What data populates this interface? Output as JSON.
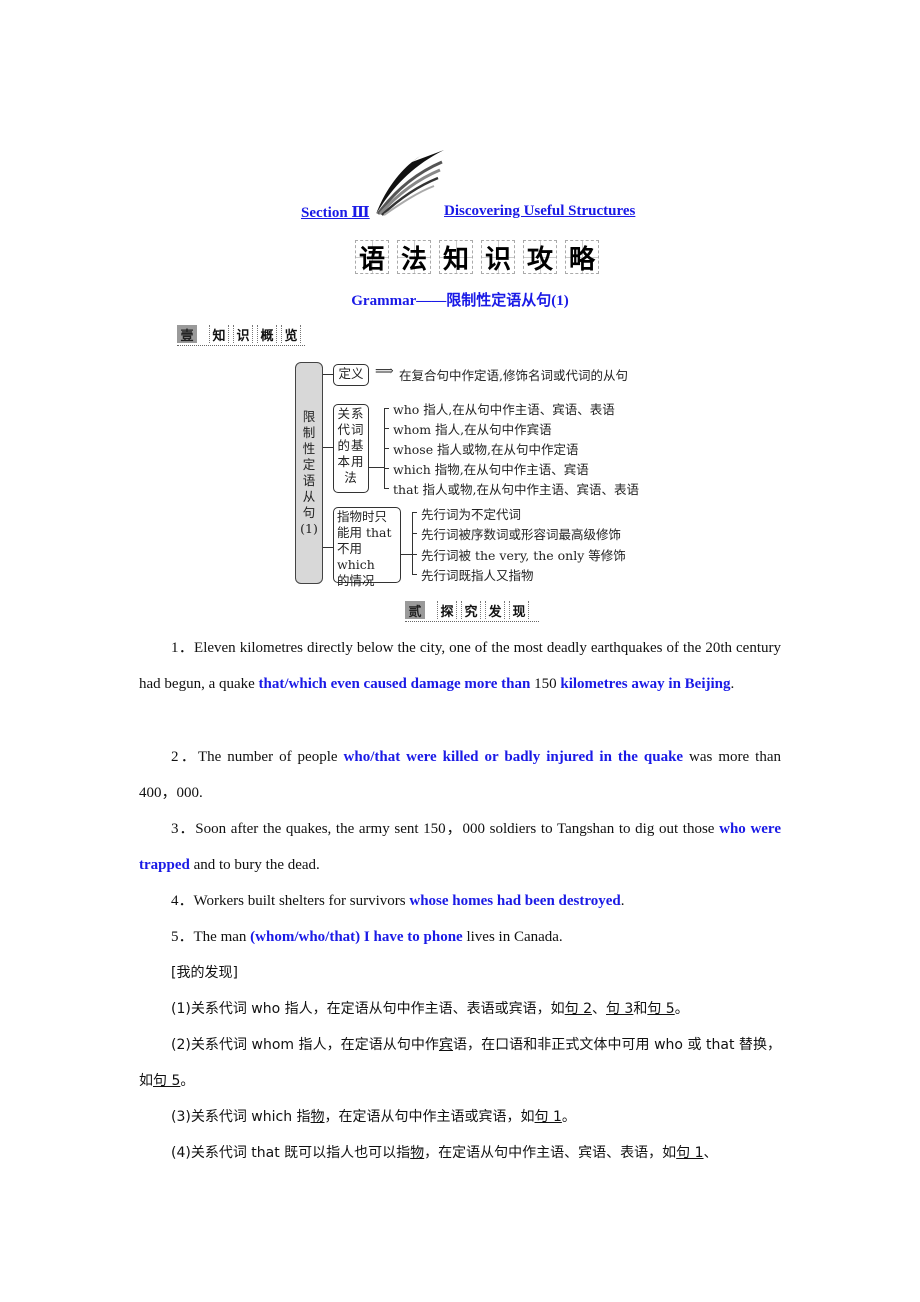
{
  "header": {
    "section_label": "Section Ⅲ",
    "section_title": "Discovering Useful Structures",
    "main_title_chars": [
      "语",
      "法",
      "知",
      "识",
      "攻",
      "略"
    ],
    "subtitle": "Grammar——限制性定语从句(1)"
  },
  "section1": {
    "badge": "壹",
    "chars": [
      "知",
      "识",
      "概",
      "览"
    ]
  },
  "diagram": {
    "root_chars": [
      "限",
      "制",
      "性",
      "定",
      "语",
      "从",
      "句",
      "(1)"
    ],
    "definition_label": "定义",
    "definition_text": "在复合句中作定语,修饰名词或代词的从句",
    "relative_label": "关系代词的基本用法",
    "relative_items": [
      "who 指人,在从句中作主语、宾语、表语",
      "whom 指人,在从句中作宾语",
      "whose 指人或物,在从句中作定语",
      "which 指物,在从句中作主语、宾语",
      "that 指人或物,在从句中作主语、宾语、表语"
    ],
    "that_label_lines": [
      "指物时只",
      "能用 that",
      "不用which",
      "的情况"
    ],
    "that_items": [
      "先行词为不定代词",
      "先行词被序数词或形容词最高级修饰",
      "先行词被 the very, the only 等修饰",
      "先行词既指人又指物"
    ]
  },
  "section2": {
    "badge": "贰",
    "chars": [
      "探",
      "究",
      "发",
      "现"
    ]
  },
  "sentences": [
    {
      "num": "1．",
      "p1": "Eleven kilometres directly below the city, one of the most deadly earthquakes of the 20th century had begun, a quake ",
      "h1": "that/which even caused damage more than",
      "p2": " 150 ",
      "h2": "kilometres away in Beijing",
      "p3": "."
    },
    {
      "num": "2．",
      "p1": "The number of people ",
      "h1": "who/that were killed or badly injured in the quake",
      "p2": " was more than 400，000."
    },
    {
      "num": "3．",
      "p1": "Soon after the quakes, the army sent 150，000 soldiers to Tangshan to dig out those ",
      "h1": "who were trapped",
      "p2": " and to bury the dead."
    },
    {
      "num": "4．",
      "p1": "Workers built shelters for survivors ",
      "h1": "whose homes had been destroyed",
      "p2": "."
    },
    {
      "num": "5．",
      "p1": "The man ",
      "h1": "(whom/who/that) I have to phone",
      "p2": " lives in Canada."
    }
  ],
  "findings": {
    "heading": "[我的发现]",
    "items": [
      {
        "a": "(1)关系代词 who 指人，在定语从句中作主语、表语或宾语，如",
        "u1": "句 2",
        "b": "、",
        "u2": "句 3",
        "c": "和",
        "u3": "句 5",
        "d": "。"
      },
      {
        "a": "(2)关系代词 whom 指人，在定语从句中作",
        "u1": "宾",
        "b": "语，在口语和非正式文体中可用 who 或 that 替换，如",
        "u2": "句 5",
        "c": "。"
      },
      {
        "a": "(3)关系代词 which 指",
        "u1": "物",
        "b": "，在定语从句中作主语或宾语，如",
        "u2": "句 1",
        "c": "。"
      },
      {
        "a": "(4)关系代词 that 既可以指人也可以指",
        "u1": "物",
        "b": "，在定语从句中作主语、宾语、表语，如",
        "u2": "句 1",
        "c": "、"
      }
    ]
  },
  "colors": {
    "highlight": "#1a1ae6",
    "text": "#111111"
  }
}
